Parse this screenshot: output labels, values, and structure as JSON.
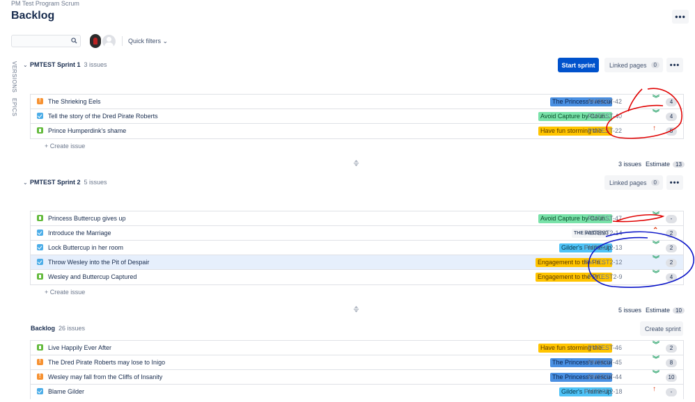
{
  "header": {
    "breadcrumb": "PM Test Program Scrum",
    "title": "Backlog",
    "more": "•••"
  },
  "toolbar": {
    "search_placeholder": "",
    "quick_filters": "Quick filters ⌄"
  },
  "side_tabs": {
    "versions": "VERSIONS",
    "epics": "EPICS"
  },
  "sprints": [
    {
      "name": "PMTEST Sprint 1",
      "count": "3 issues",
      "start_label": "Start sprint",
      "linked_pages": "Linked pages",
      "linked_count": "0",
      "more": "•••",
      "create": "+  Create issue",
      "footer_issues": "3 issues",
      "footer_estimate": "Estimate",
      "footer_total": "13",
      "issues": [
        {
          "type": "bug",
          "summary": "The Shrieking Eels",
          "epic": "The Princess's rescue",
          "color": "blue",
          "key": "PMTEST-42",
          "priority": "low",
          "priority_glyph": "︾",
          "estimate": "4"
        },
        {
          "type": "task",
          "summary": "Tell the story of the Dred Pirate Roberts",
          "epic": "Avoid Capture by Coun...",
          "color": "green",
          "key": "PMTEST-40",
          "priority": "low",
          "priority_glyph": "︾",
          "estimate": "4"
        },
        {
          "type": "story",
          "summary": "Prince Humperdink's shame",
          "epic": "Have fun storming the ...",
          "color": "yellow",
          "key": "PMTEST-22",
          "priority": "high",
          "priority_glyph": "↑",
          "estimate": "5"
        }
      ]
    },
    {
      "name": "PMTEST Sprint 2",
      "count": "5 issues",
      "linked_pages": "Linked pages",
      "linked_count": "0",
      "more": "•••",
      "create": "+  Create issue",
      "footer_issues": "5 issues",
      "footer_estimate": "Estimate",
      "footer_total": "10",
      "issues": [
        {
          "type": "story",
          "summary": "Princess Buttercup gives up",
          "epic": "Avoid Capture by Coun...",
          "color": "green",
          "key": "PMTEST-47",
          "priority": "low",
          "priority_glyph": "︾",
          "estimate": "-"
        },
        {
          "type": "task",
          "summary": "Introduce the Marriage",
          "epic": "THE WEDDING",
          "color": "gray",
          "key": "PMTEST2-14",
          "priority": "high",
          "priority_glyph": "⌃",
          "estimate": "2"
        },
        {
          "type": "task",
          "summary": "Lock Buttercup in her room",
          "epic": "Gilder's Frame-up",
          "color": "cyan",
          "key": "PMTEST2-13",
          "priority": "low",
          "priority_glyph": "︾",
          "estimate": "2"
        },
        {
          "type": "task",
          "summary": "Throw Wesley into the Pit of Despair",
          "epic": "Engagement to the Pri...",
          "color": "yellow",
          "key": "PMTEST2-12",
          "priority": "low",
          "priority_glyph": "︾",
          "estimate": "2"
        },
        {
          "type": "story",
          "summary": "Wesley and Buttercup Captured",
          "epic": "Engagement to the Pri...",
          "color": "yellow",
          "key": "PMTEST2-9",
          "priority": "low",
          "priority_glyph": "︾",
          "estimate": "4"
        }
      ]
    }
  ],
  "backlog": {
    "name": "Backlog",
    "count": "26 issues",
    "create_sprint": "Create sprint",
    "issues": [
      {
        "type": "story",
        "summary": "Live Happily Ever After",
        "epic": "Have fun storming the ...",
        "color": "yellow",
        "key": "PMTEST-46",
        "priority": "low",
        "priority_glyph": "︾",
        "estimate": "2"
      },
      {
        "type": "bug",
        "summary": "The Dred Pirate Roberts may lose to Inigo",
        "epic": "The Princess's rescue",
        "color": "blue",
        "key": "PMTEST-45",
        "priority": "low",
        "priority_glyph": "︾",
        "estimate": "8"
      },
      {
        "type": "bug",
        "summary": "Wesley may fall from the Cliffs of Insanity",
        "epic": "The Princess's rescue",
        "color": "blue",
        "key": "PMTEST-44",
        "priority": "low",
        "priority_glyph": "︾",
        "estimate": "10"
      },
      {
        "type": "task",
        "summary": "Blame Gilder",
        "epic": "Gilder's Frame-up",
        "color": "cyan",
        "key": "PMTEST2-18",
        "priority": "high",
        "priority_glyph": "↑",
        "estimate": "-"
      }
    ]
  },
  "colors": {
    "accent": "#0052cc",
    "annotation_red": "#e00000",
    "annotation_blue": "#0a14c8"
  }
}
